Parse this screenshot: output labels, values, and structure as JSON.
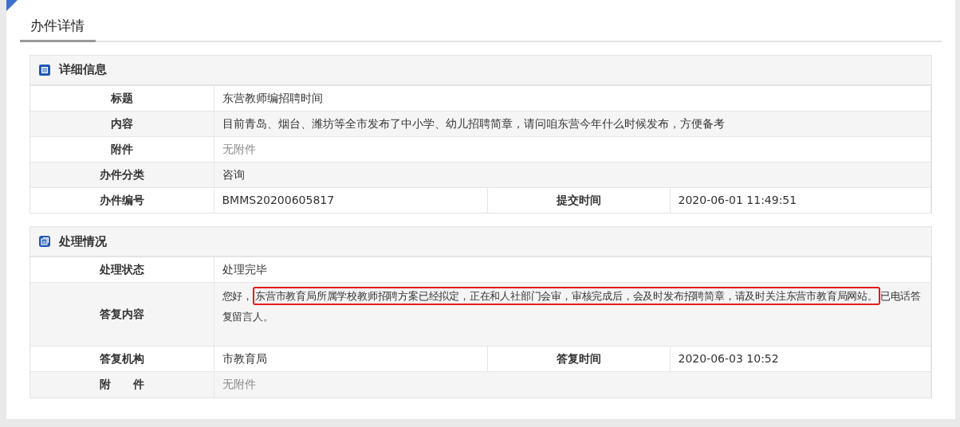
{
  "page_tab": {
    "label": "办件详情",
    "selected": true
  },
  "sections": [
    {
      "title": "详细信息",
      "rows": [
        {
          "kind": "single",
          "label": "标题",
          "value": "东营教师编招聘时间",
          "muted": false
        },
        {
          "kind": "single",
          "label": "内容",
          "value": "目前青岛、烟台、潍坊等全市发布了中小学、幼儿招聘简章，请问咱东营今年什么时候发布，方便备考",
          "muted": false
        },
        {
          "kind": "single",
          "label": "附件",
          "value": "无附件",
          "muted": true
        },
        {
          "kind": "single",
          "label": "办件分类",
          "value": "咨询",
          "muted": false
        },
        {
          "kind": "double",
          "label": "办件编号",
          "value": "BMMS20200605817",
          "label2": "提交时间",
          "value2": "2020-06-01 11:49:51"
        }
      ]
    },
    {
      "title": "处理情况",
      "rows": [
        {
          "kind": "single",
          "label": "处理状态",
          "value": "处理完毕",
          "muted": false
        },
        {
          "kind": "reply",
          "label": "答复内容",
          "before": "您好，",
          "highlighted": "东营市教育局所属学校教师招聘方案已经拟定，正在和人社部门会审，审核完成后，会及时发布招聘简章，请及时关注东营市教育局网站。",
          "after": "已电话答复留言人。"
        },
        {
          "kind": "double",
          "label": "答复机构",
          "value": "市教育局",
          "label2": "答复时间",
          "value2": "2020-06-03 10:52"
        },
        {
          "kind": "single",
          "label": "附　　件",
          "value": "无附件",
          "muted": true
        }
      ]
    }
  ]
}
